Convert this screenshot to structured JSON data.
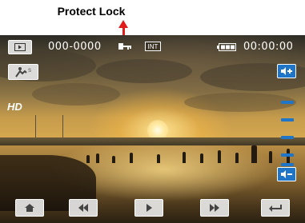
{
  "callout": {
    "label": "Protect Lock",
    "color": "#e21b1b"
  },
  "topbar": {
    "file_number": "000-0000",
    "media_badge": "INT",
    "time": "00:00:00"
  },
  "overlay": {
    "hd_label": "HD"
  },
  "volume": {
    "levels": 5
  },
  "colors": {
    "accent": "#1f75c8",
    "button_bg": "#ebebeb"
  }
}
